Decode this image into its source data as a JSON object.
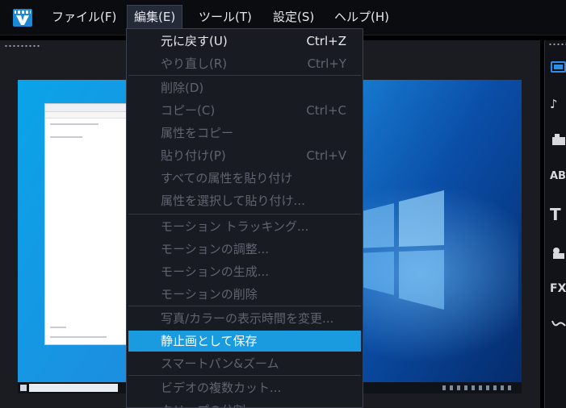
{
  "menubar": {
    "items": [
      {
        "label": "ファイル(F)"
      },
      {
        "label": "編集(E)"
      },
      {
        "label": "ツール(T)"
      },
      {
        "label": "設定(S)"
      },
      {
        "label": "ヘルプ(H)"
      }
    ]
  },
  "edit_menu": {
    "items": [
      {
        "label": "元に戻す(U)",
        "shortcut": "Ctrl+Z",
        "enabled": true
      },
      {
        "label": "やり直し(R)",
        "shortcut": "Ctrl+Y",
        "enabled": false
      },
      {
        "label": "削除(D)",
        "shortcut": "",
        "enabled": false
      },
      {
        "label": "コピー(C)",
        "shortcut": "Ctrl+C",
        "enabled": false
      },
      {
        "label": "属性をコピー",
        "shortcut": "",
        "enabled": false
      },
      {
        "label": "貼り付け(P)",
        "shortcut": "Ctrl+V",
        "enabled": false
      },
      {
        "label": "すべての属性を貼り付け",
        "shortcut": "",
        "enabled": false
      },
      {
        "label": "属性を選択して貼り付け...",
        "shortcut": "",
        "enabled": false
      },
      {
        "label": "モーション トラッキング...",
        "shortcut": "",
        "enabled": false
      },
      {
        "label": "モーションの調整...",
        "shortcut": "",
        "enabled": false
      },
      {
        "label": "モーションの生成...",
        "shortcut": "",
        "enabled": false
      },
      {
        "label": "モーションの削除",
        "shortcut": "",
        "enabled": false
      },
      {
        "label": "写真/カラーの表示時間を変更...",
        "shortcut": "",
        "enabled": false
      },
      {
        "label": "静止画として保存",
        "shortcut": "",
        "enabled": true,
        "highlighted": true
      },
      {
        "label": "スマートパン&ズーム",
        "shortcut": "",
        "enabled": false
      },
      {
        "label": "ビデオの複数カット...",
        "shortcut": "",
        "enabled": false
      },
      {
        "label": "クリップの分割",
        "shortcut": "",
        "enabled": false
      }
    ]
  },
  "tool_strip": {
    "items": [
      {
        "icon": "media-library-icon",
        "selected": true
      },
      {
        "icon": "music-note-icon",
        "label": "♪"
      },
      {
        "icon": "instant-project-icon"
      },
      {
        "icon": "title-ab-icon",
        "label": "AB"
      },
      {
        "icon": "text-t-icon",
        "label": "T"
      },
      {
        "icon": "graphics-icon"
      },
      {
        "icon": "fx-filter-icon",
        "label": "FX"
      },
      {
        "icon": "path-icon"
      }
    ]
  },
  "colors": {
    "highlight": "#1a9be0",
    "menu_bg": "#191b22",
    "disabled_text": "#5f6470"
  }
}
